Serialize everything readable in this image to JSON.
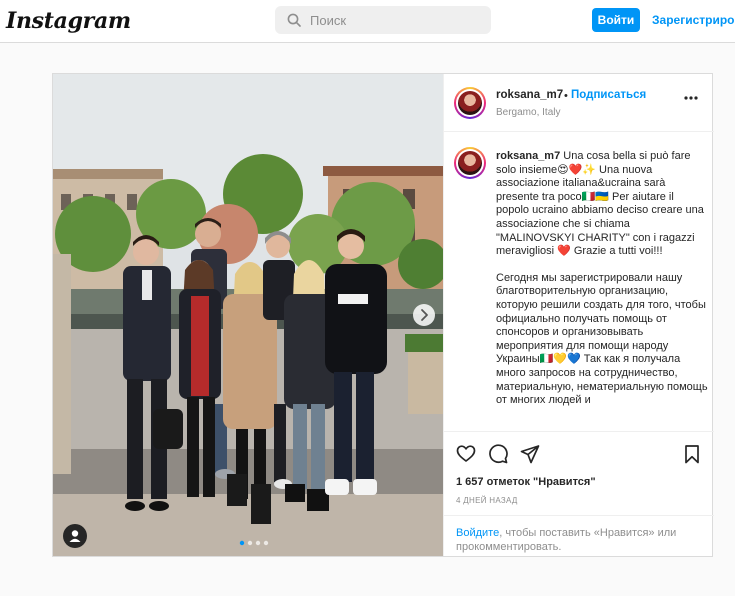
{
  "nav": {
    "logo": "Instagram",
    "search_placeholder": "Поиск",
    "login_label": "Войти",
    "signup_label": "Зарегистрироваться"
  },
  "post": {
    "username": "roksana_m7",
    "separator": "•",
    "follow_label": "Подписаться",
    "location": "Bergamo, Italy",
    "caption": {
      "username": "roksana_m7",
      "paragraph_1": "Una cosa bella si può fare solo insieme😍❤️✨ Una nuova associazione italiana&ucraina sarà presente tra poco🇮🇹🇺🇦 Per aiutare il popolo ucraino abbiamo deciso creare una associazione che si chiama \"MALINOVSKYI CHARITY\" con i ragazzi meravigliosi ❤️ Grazie a tutti voi!!!",
      "paragraph_2": "Сегодня мы зарегистрировали нашу благотворительную организацию, которую решили создать для того, чтобы официально получать помощь от спонсоров и организовывать мероприятия для помощи народу Украины🇮🇹💛💙 Так как я получала много запросов на сотрудничество, материальную, нематериальную помощь от многих людей и"
    },
    "likes": "1 657 отметок \"Нравится\"",
    "time": "4 ДНЕЙ НАЗАД",
    "prompt_link": "Войдите",
    "prompt_rest": ", чтобы поставить «Нравится» или прокомментировать."
  },
  "icons": {
    "search": "search-icon",
    "more": "more-options-icon",
    "like": "heart-icon",
    "comment": "comment-icon",
    "share": "share-icon",
    "save": "bookmark-icon",
    "next": "chevron-right-icon",
    "tags": "user-tag-icon"
  },
  "colors": {
    "accent": "#0095f6",
    "text": "#262626",
    "muted": "#8e8e8e",
    "border": "#dbdbdb"
  }
}
